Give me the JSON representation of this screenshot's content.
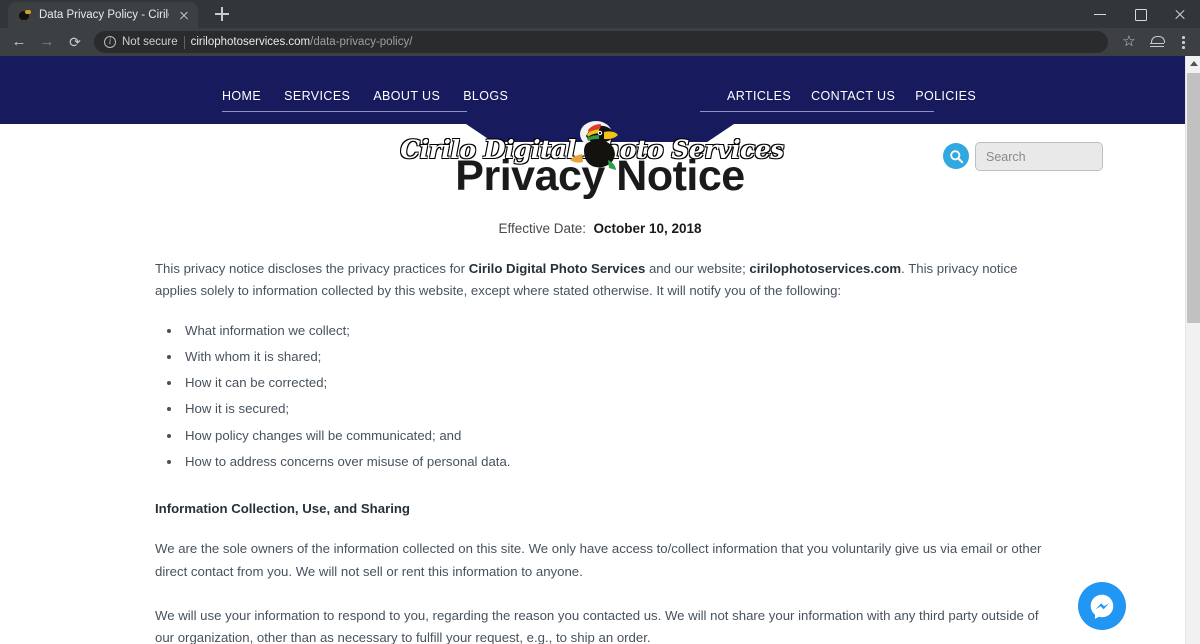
{
  "browser": {
    "tab": {
      "title": "Data Privacy Policy - Cirilo Digital",
      "favicon": "toucan-favicon",
      "close_label": ""
    },
    "new_tab_label": "",
    "window": {
      "minimize": "",
      "maximize": "",
      "close": ""
    },
    "nav": {
      "back": "←",
      "forward": "→",
      "reload": "⟳"
    },
    "omnibox": {
      "security_label": "Not secure",
      "url_domain": "cirilophotoservices.com",
      "url_path": "/data-privacy-policy/"
    },
    "actions": {
      "bookmark": "",
      "profile": "",
      "menu": ""
    }
  },
  "site": {
    "nav_left": [
      {
        "label": "HOME"
      },
      {
        "label": "SERVICES"
      },
      {
        "label": "ABOUT US"
      },
      {
        "label": "BLOGS"
      }
    ],
    "nav_right": [
      {
        "label": "ARTICLES"
      },
      {
        "label": "CONTACT US"
      },
      {
        "label": "POLICIES"
      }
    ],
    "logo": {
      "text": "Cirilo Digital Photo Services"
    },
    "search": {
      "placeholder": "Search",
      "value": "",
      "button_label": ""
    },
    "colors": {
      "banner_navy": "#171b5e",
      "search_button_cyan": "#31a8e0",
      "messenger_blue": "#2196f3",
      "body_text": "#47525d"
    }
  },
  "page": {
    "title": "Privacy Notice",
    "effective_date_label": "Effective Date:",
    "effective_date_value": "October 10, 2018",
    "intro": {
      "part1": "This privacy notice discloses the privacy practices for ",
      "bold1": "Cirilo Digital Photo Services",
      "part2": " and our website; ",
      "bold2": "cirilophotoservices.com",
      "part3": ". This privacy notice applies solely to information collected by this website, except where stated otherwise. It will notify you of the following:"
    },
    "bullets": [
      "What information we collect;",
      "With whom it is shared;",
      "How it can be corrected;",
      "How it is secured;",
      "How policy changes will be communicated; and",
      "How to address concerns over misuse of personal data."
    ],
    "section_heading": "Information Collection, Use, and Sharing",
    "paragraph1": "We are the sole owners of the information collected on this site. We only have access to/collect information that you voluntarily give us via email or other direct contact from you. We will not sell or rent this information to anyone.",
    "paragraph2": "We will use your information to respond to you, regarding the reason you contacted us. We will not share your information with any third party outside of our organization, other than as necessary to fulfill your request, e.g., to ship an order."
  },
  "widgets": {
    "messenger": {
      "label": "messenger-chat"
    }
  }
}
